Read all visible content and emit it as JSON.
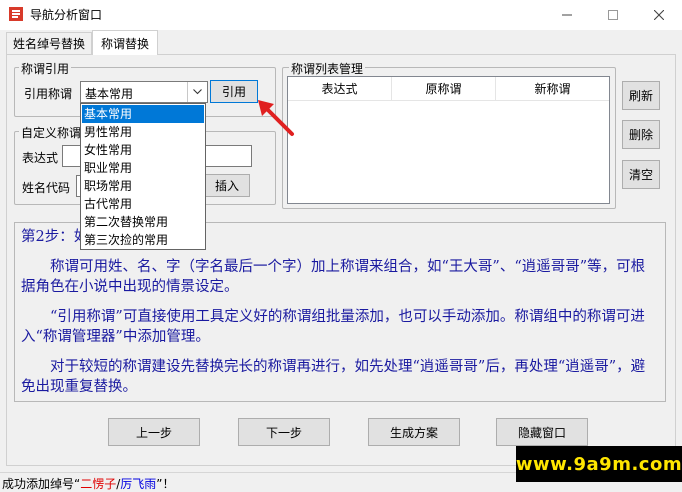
{
  "window": {
    "title": "导航分析窗口"
  },
  "tabs": [
    {
      "label": "姓名绰号替换"
    },
    {
      "label": "称谓替换"
    }
  ],
  "cite_group": {
    "title": "称谓引用",
    "field_label": "引用称谓",
    "selected": "基本常用",
    "button": "引用",
    "options": [
      "基本常用",
      "男性常用",
      "女性常用",
      "职业常用",
      "职场常用",
      "古代常用",
      "第二次替换常用",
      "第三次捡的常用"
    ]
  },
  "custom_group": {
    "title": "自定义称谓",
    "expr_label": "表达式",
    "code_label": "姓名代码",
    "insert_button": "插入"
  },
  "list_group": {
    "title": "称谓列表管理",
    "columns": [
      "表达式",
      "原称谓",
      "新称谓"
    ],
    "buttons": {
      "refresh": "刷新",
      "delete": "删除",
      "clear": "清空"
    }
  },
  "info": {
    "step": "第2步：如",
    "p1": "称谓可用姓、名、字（字名最后一个字）加上称谓来组合，如“王大哥”、“逍遥哥哥”等，可根据角色在小说中出现的情景设定。",
    "p2": "“引用称谓”可直接使用工具定义好的称谓组批量添加，也可以手动添加。称谓组中的称谓可进入“称谓管理器”中添加管理。",
    "p3": "对于较短的称谓建设先替换完长的称谓再进行，如先处理“逍遥哥哥”后，再处理“逍遥哥”，避免出现重复替换。"
  },
  "nav_buttons": {
    "prev": "上一步",
    "next": "下一步",
    "generate": "生成方案",
    "hide": "隐藏窗口"
  },
  "status": {
    "prefix": "成功添加绰号“",
    "name1": "二愣子",
    "sep": "/",
    "name2": "厉飞雨",
    "suffix": "”！"
  },
  "watermark": "www.9a9m.com",
  "colors": {
    "selection": "#0078d7",
    "info_text": "#1a1aa0",
    "status_name1": "#e00000",
    "status_name2": "#0000e0",
    "arrow": "#e02020"
  }
}
